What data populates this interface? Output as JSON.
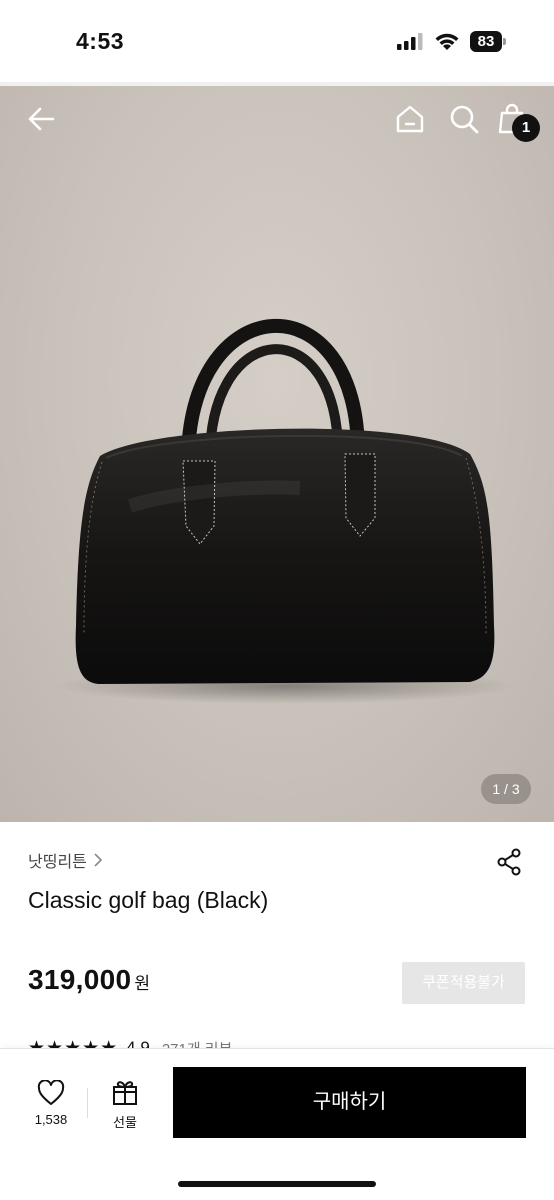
{
  "status_bar": {
    "time": "4:53",
    "battery": "83"
  },
  "product_image": {
    "counter": "1 / 3",
    "cart_badge": "1"
  },
  "product": {
    "brand": "낫띵리튼",
    "title": "Classic golf bag (Black)",
    "price": "319,000",
    "price_unit": "원",
    "coupon_label": "쿠폰적용불가",
    "rating_stars": "★★★★★",
    "rating": "4.9",
    "review_count": "271개 리뷰"
  },
  "bottom_bar": {
    "like_count": "1,538",
    "gift_label": "선물",
    "buy_label": "구매하기"
  },
  "colors": {
    "accent": "#000000",
    "background": "#ffffff",
    "photo_background": "#ccc5bd",
    "disabled_button": "#e6e6e6"
  },
  "icons": [
    "back-arrow-icon",
    "home-icon",
    "search-icon",
    "shopping-bag-icon",
    "chevron-right-icon",
    "share-icon",
    "heart-icon",
    "gift-icon",
    "signal-icon",
    "wifi-icon",
    "battery-icon"
  ]
}
